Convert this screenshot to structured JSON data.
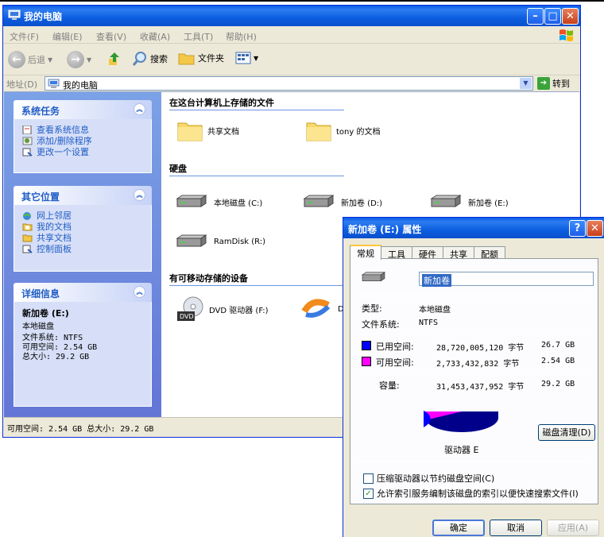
{
  "explorer": {
    "title": "我的电脑",
    "menu": [
      "文件(F)",
      "编辑(E)",
      "查看(V)",
      "收藏(A)",
      "工具(T)",
      "帮助(H)"
    ],
    "toolbar": {
      "back": "后退",
      "search": "搜索",
      "folders": "文件夹"
    },
    "address": {
      "label": "地址(D)",
      "value": "我的电脑",
      "go": "转到"
    },
    "sidebar": {
      "system_tasks": {
        "title": "系统任务",
        "items": [
          "查看系统信息",
          "添加/删除程序",
          "更改一个设置"
        ]
      },
      "other_places": {
        "title": "其它位置",
        "items": [
          "网上邻居",
          "我的文档",
          "共享文档",
          "控制面板"
        ]
      },
      "details": {
        "title": "详细信息",
        "name": "新加卷 (E:)",
        "type": "本地磁盘",
        "fs": "文件系统: NTFS",
        "free": "可用空间: 2.54 GB",
        "total": "总大小: 29.2 GB"
      }
    },
    "sections": {
      "stored_files": "在这台计算机上存储的文件",
      "hard_disks": "硬盘",
      "removable": "有可移动存储的设备"
    },
    "files": [
      "共享文档",
      "tony 的文档"
    ],
    "drives": [
      "本地磁盘 (C:)",
      "新加卷 (D:)",
      "新加卷 (E:)",
      "RamDisk (R:)"
    ],
    "removable": [
      "DVD 驱动器 (F:)",
      "DV"
    ],
    "status": "可用空间: 2.54 GB 总大小: 29.2 GB"
  },
  "dialog": {
    "title": "新加卷 (E:) 属性",
    "tabs": [
      "常规",
      "工具",
      "硬件",
      "共享",
      "配额"
    ],
    "name_value": "新加卷",
    "type_label": "类型:",
    "type_value": "本地磁盘",
    "fs_label": "文件系统:",
    "fs_value": "NTFS",
    "used_label": "已用空间:",
    "used_bytes": "28,720,005,120 字节",
    "used_gb": "26.7 GB",
    "free_label": "可用空间:",
    "free_bytes": "2,733,432,832 字节",
    "free_gb": "2.54 GB",
    "cap_label": "容量:",
    "cap_bytes": "31,453,437,952 字节",
    "cap_gb": "29.2 GB",
    "drive_label": "驱动器 E",
    "cleanup": "磁盘清理(D)",
    "compress": "压缩驱动器以节约磁盘空间(C)",
    "index": "允许索引服务编制该磁盘的索引以便快速搜索文件(I)",
    "compress_checked": false,
    "index_checked": true,
    "ok": "确定",
    "cancel": "取消",
    "apply": "应用(A)",
    "colors": {
      "used": "#0000ff",
      "free": "#ff00ff"
    },
    "pie": {
      "used_fraction": 0.9131,
      "free_fraction": 0.0869
    }
  }
}
